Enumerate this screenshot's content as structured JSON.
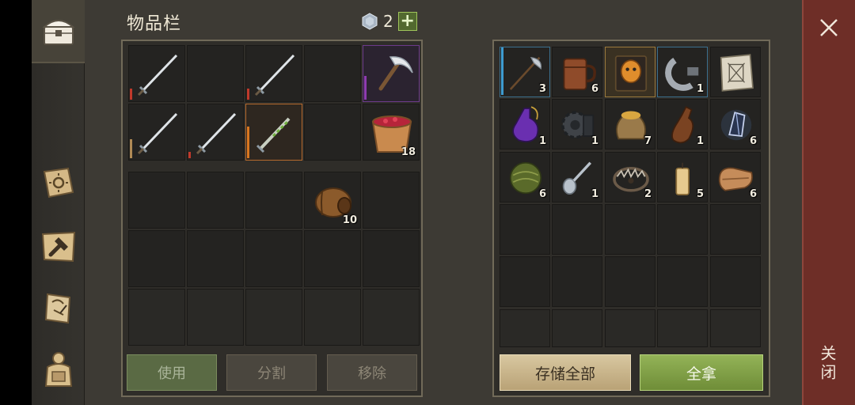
{
  "inventory": {
    "title": "物品栏",
    "gem_count": "2",
    "buttons": {
      "use": "使用",
      "split": "分割",
      "remove": "移除"
    },
    "items": [
      {
        "icon": "longsword-icon",
        "qty": ""
      },
      {
        "icon": "longsword-icon",
        "qty": ""
      },
      {
        "icon": "scythe-icon",
        "qty": ""
      },
      {
        "icon": "longsword-icon",
        "qty": ""
      },
      {
        "icon": "longsword-icon",
        "qty": ""
      },
      {
        "icon": "poisoned-dagger-icon",
        "qty": ""
      },
      {
        "icon": "berry-bucket-icon",
        "qty": "18"
      },
      {
        "icon": "barrel-icon",
        "qty": "10"
      }
    ]
  },
  "storage": {
    "buttons": {
      "store_all": "存储全部",
      "take_all": "全拿"
    },
    "items": [
      {
        "icon": "halberd-icon",
        "qty": "3"
      },
      {
        "icon": "tankard-icon",
        "qty": "6"
      },
      {
        "icon": "mask-book-icon",
        "qty": ""
      },
      {
        "icon": "iron-clamp-icon",
        "qty": "1"
      },
      {
        "icon": "map-scroll-icon",
        "qty": ""
      },
      {
        "icon": "potion-flask-icon",
        "qty": "1"
      },
      {
        "icon": "gear-part-icon",
        "qty": "1"
      },
      {
        "icon": "grain-sack-icon",
        "qty": "7"
      },
      {
        "icon": "bottle-icon",
        "qty": "1"
      },
      {
        "icon": "crystal-shard-icon",
        "qty": "6"
      },
      {
        "icon": "hay-ball-icon",
        "qty": "6"
      },
      {
        "icon": "spoon-icon",
        "qty": "1"
      },
      {
        "icon": "bear-trap-icon",
        "qty": "2"
      },
      {
        "icon": "candle-icon",
        "qty": "5"
      },
      {
        "icon": "cloth-roll-icon",
        "qty": "6"
      }
    ]
  },
  "close_label": "关闭",
  "colors": {
    "accent_green": "#7f9f45",
    "store_button": "#c9b58c",
    "close_panel": "#6e2e27",
    "durability_red": "#c0392b",
    "durability_tan": "#b08a55",
    "rarity_purple": "#8e3bb0",
    "rarity_orange": "#d9761f",
    "rarity_blue": "#3d9bd0"
  }
}
